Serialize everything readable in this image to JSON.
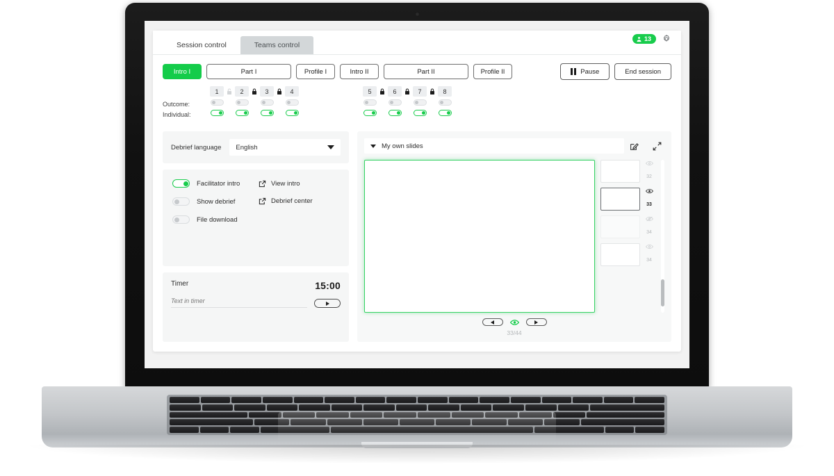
{
  "window": {
    "tabs": [
      {
        "label": "Session control",
        "active": true
      },
      {
        "label": "Teams control",
        "active": false
      }
    ],
    "participants_badge": "13",
    "participants_icon": "person-icon",
    "settings_icon": "gear-icon"
  },
  "phases": [
    {
      "label": "Intro I",
      "active": true,
      "size": "sm"
    },
    {
      "label": "Part I",
      "active": false,
      "size": "lg"
    },
    {
      "label": "Profile I",
      "active": false,
      "size": "sm"
    },
    {
      "label": "Intro II",
      "active": false,
      "size": "sm"
    },
    {
      "label": "Part II",
      "active": false,
      "size": "lg"
    },
    {
      "label": "Profile II",
      "active": false,
      "size": "sm"
    }
  ],
  "session_controls": {
    "pause_label": "Pause",
    "pause_icon": "pause-icon",
    "end_label": "End session"
  },
  "matrix": {
    "row_labels": {
      "outcome": "Outcome:",
      "individual": "Individual:"
    },
    "group_a": {
      "numbers": [
        "1",
        "2",
        "3",
        "4"
      ],
      "locks": [
        "unlocked",
        "locked",
        "locked"
      ],
      "outcome": [
        false,
        false,
        false,
        false
      ],
      "individual": [
        true,
        true,
        true,
        true
      ]
    },
    "group_b": {
      "numbers": [
        "5",
        "6",
        "7",
        "8"
      ],
      "locks": [
        "locked",
        "locked",
        "locked"
      ],
      "outcome": [
        false,
        false,
        false,
        false
      ],
      "individual": [
        true,
        true,
        true,
        true
      ]
    }
  },
  "language": {
    "label": "Debrief language",
    "selected": "English",
    "caret_icon": "chevron-down-icon"
  },
  "options": {
    "toggles": [
      {
        "label": "Facilitator intro",
        "on": true
      },
      {
        "label": "Show debrief",
        "on": false
      },
      {
        "label": "File download",
        "on": false
      }
    ],
    "links": [
      {
        "label": "View intro",
        "icon": "external-link-icon"
      },
      {
        "label": "Debrief center",
        "icon": "external-link-icon"
      }
    ]
  },
  "timer": {
    "title": "Timer",
    "value": "15:00",
    "input_placeholder": "Text in timer",
    "input_value": "",
    "play_icon": "play-icon"
  },
  "slides": {
    "deck_name": "My own slides",
    "deck_caret_icon": "chevron-down-icon",
    "edit_icon": "edit-icon",
    "expand_icon": "expand-icon",
    "thumbnails": [
      {
        "number": "32",
        "selected": false,
        "visibility": "visible-dim",
        "dim": false
      },
      {
        "number": "33",
        "selected": true,
        "visibility": "visible",
        "dim": false
      },
      {
        "number": "34",
        "selected": false,
        "visibility": "hidden",
        "dim": true
      },
      {
        "number": "34",
        "selected": false,
        "visibility": "visible-dim",
        "dim": false
      }
    ],
    "nav": {
      "prev_icon": "arrow-left-icon",
      "present_icon": "eye-icon",
      "next_icon": "arrow-right-icon",
      "counter": "33/44"
    }
  },
  "colors": {
    "accent_green": "#14cc4a",
    "badge_green": "#18cc4c",
    "slide_border_green": "#35d163",
    "tab_inactive": "#d3d7d9",
    "panel_bg": "#f5f6f6"
  }
}
